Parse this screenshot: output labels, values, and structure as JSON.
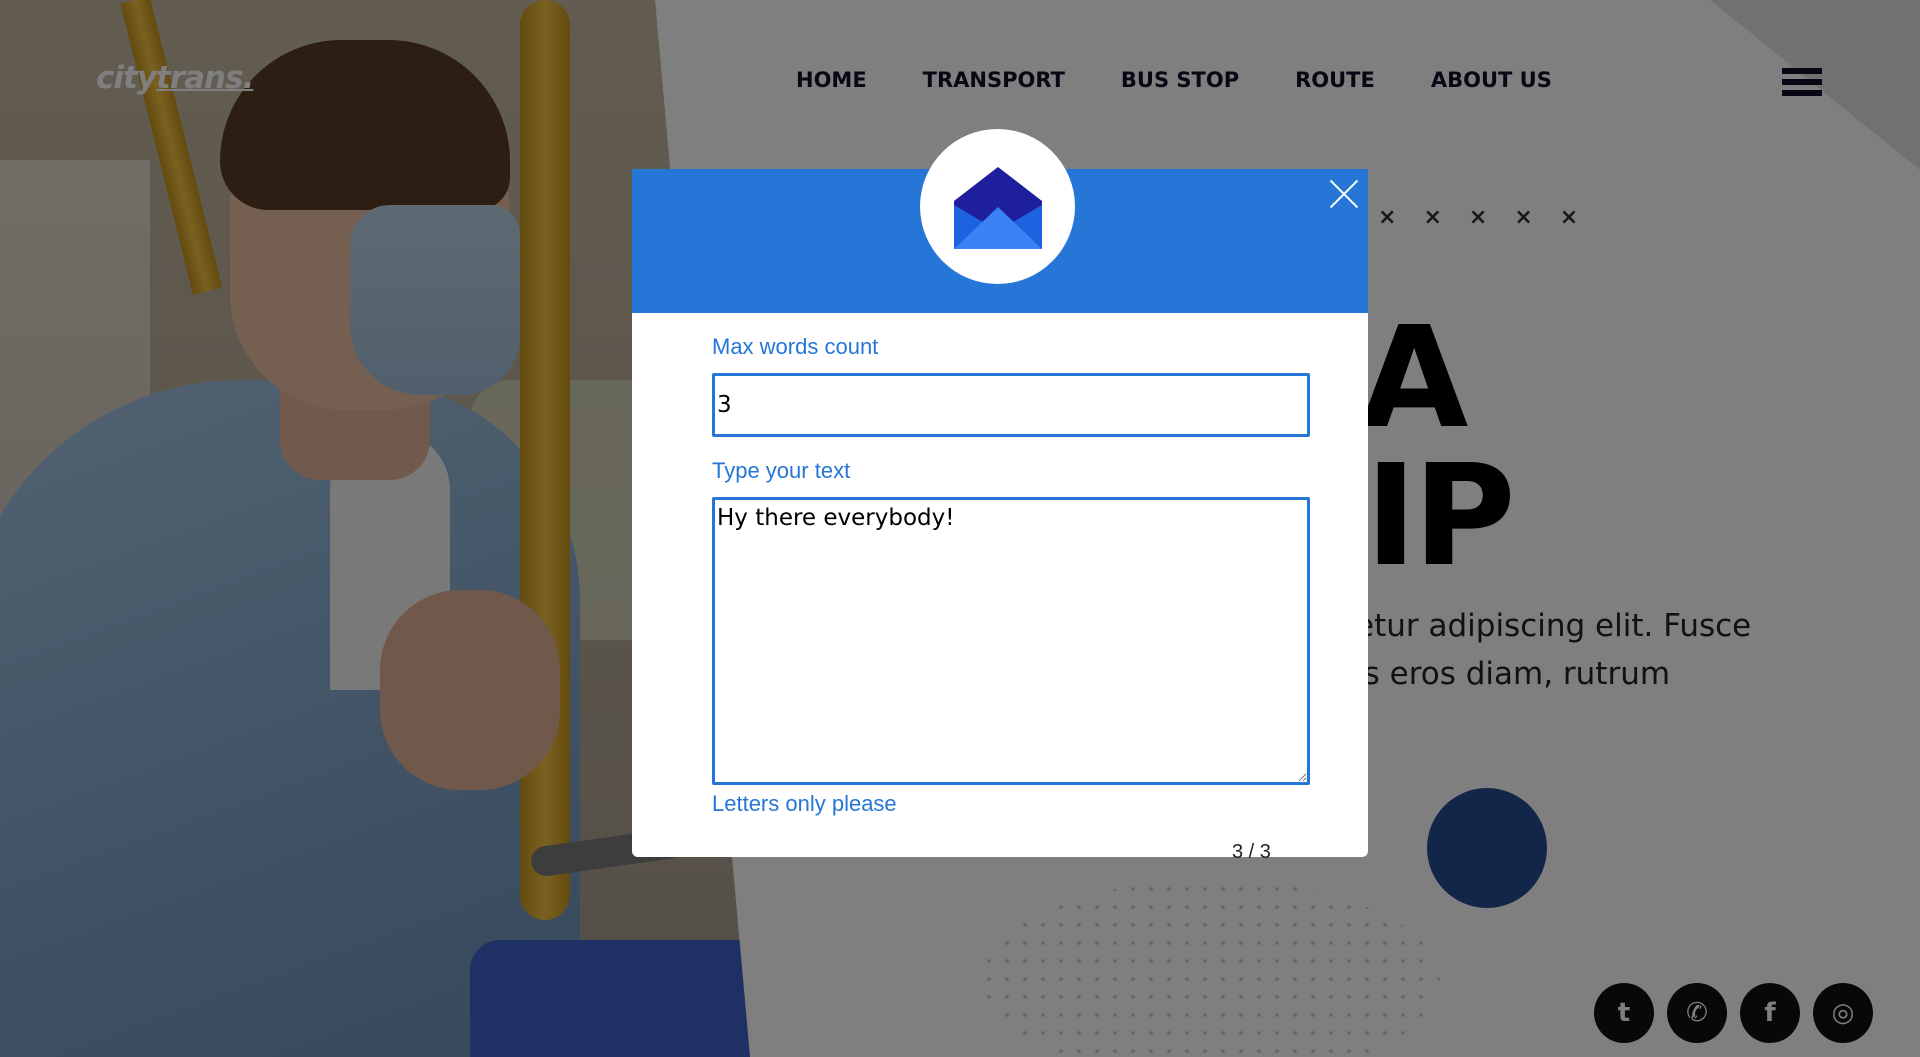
{
  "site": {
    "logo": {
      "prefix": "city",
      "accent": "trans."
    },
    "nav": [
      {
        "label": "HOME"
      },
      {
        "label": "TRANSPORT"
      },
      {
        "label": "BUS STOP"
      },
      {
        "label": "ROUTE"
      },
      {
        "label": "ABOUT US"
      }
    ],
    "decor_marks": [
      "×",
      "×",
      "×",
      "×",
      "×"
    ],
    "hero": {
      "title_line1": "A",
      "title_line2": "IP",
      "description_line1": "etur adipiscing elit. Fusce",
      "description_line2": "is eros diam, rutrum"
    },
    "socials": [
      {
        "icon": "twitter-icon",
        "glyph": "t"
      },
      {
        "icon": "whatsapp-icon",
        "glyph": "✆"
      },
      {
        "icon": "facebook-icon",
        "glyph": "f"
      },
      {
        "icon": "instagram-icon",
        "glyph": "◎"
      }
    ]
  },
  "modal": {
    "header_icon": "envelope-open-icon",
    "close_icon": "close-icon",
    "max_words_label": "Max words count",
    "max_words_value": "3",
    "text_label": "Type your text",
    "text_value": "Hy there everybody!",
    "hint": "Letters only please",
    "counter": "3 / 3"
  },
  "colors": {
    "accent": "#2576d6",
    "overlay": "rgba(0,0,0,0.5)",
    "envelope_dark": "#1e1f9c",
    "envelope_light": "#3b82f6",
    "nav_text": "#10112a",
    "circle_button": "#254c93"
  }
}
